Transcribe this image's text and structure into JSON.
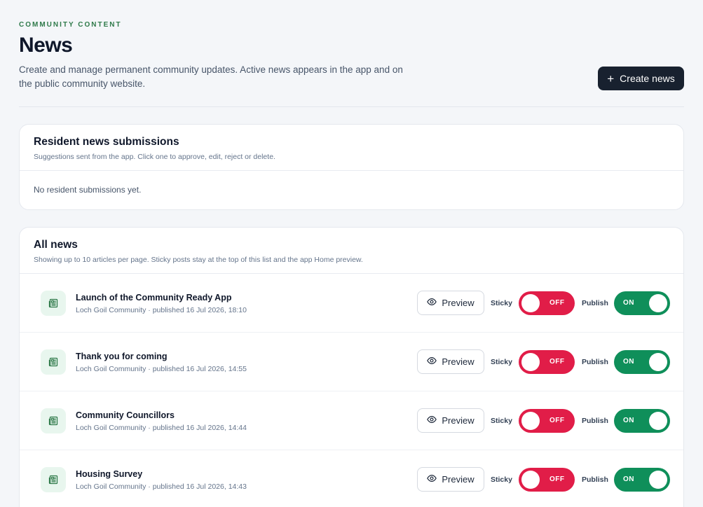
{
  "header": {
    "eyebrow": "COMMUNITY CONTENT",
    "title": "News",
    "description": "Create and manage permanent community updates. Active news appears in the app and on the public community website.",
    "create_label": "Create news"
  },
  "submissions": {
    "title": "Resident news submissions",
    "description": "Suggestions sent from the app. Click one to approve, edit, reject or delete.",
    "empty": "No resident submissions yet."
  },
  "all_news": {
    "title": "All news",
    "description": "Showing up to 10 articles per page. Sticky posts stay at the top of this list and the app Home preview.",
    "preview_label": "Preview",
    "sticky_label": "Sticky",
    "publish_label": "Publish",
    "items": [
      {
        "title": "Launch of the Community Ready App",
        "meta": "Loch Goil Community · published 16 Jul 2026, 18:10",
        "sticky": "OFF",
        "publish": "ON"
      },
      {
        "title": "Thank you for coming",
        "meta": "Loch Goil Community · published 16 Jul 2026, 14:55",
        "sticky": "OFF",
        "publish": "ON"
      },
      {
        "title": "Community Councillors",
        "meta": "Loch Goil Community · published 16 Jul 2026, 14:44",
        "sticky": "OFF",
        "publish": "ON"
      },
      {
        "title": "Housing Survey",
        "meta": "Loch Goil Community · published 16 Jul 2026, 14:43",
        "sticky": "OFF",
        "publish": "ON"
      }
    ]
  },
  "icons": {
    "create": "plus-icon",
    "row": "newspaper-icon",
    "preview": "eye-icon"
  },
  "colors": {
    "primary_button": "#18212f",
    "eyebrow": "#2f7a4a",
    "toggle_off": "#e11d48",
    "toggle_on": "#0f8f5a",
    "icon_bg": "#e8f6ee"
  }
}
